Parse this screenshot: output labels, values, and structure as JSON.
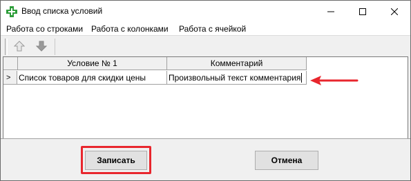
{
  "window": {
    "title": "Ввод списка условий"
  },
  "menu": {
    "items": [
      {
        "label": "Работа со строками"
      },
      {
        "label": "Работа с колонками"
      },
      {
        "label": "Работа с ячейкой"
      }
    ]
  },
  "grid": {
    "columns": [
      {
        "label": "Условие № 1"
      },
      {
        "label": "Комментарий"
      }
    ],
    "rows": [
      {
        "marker": ">",
        "condition": "Список товаров для скидки цены",
        "comment": "Произвольный текст комментария"
      }
    ]
  },
  "buttons": {
    "save": "Записать",
    "cancel": "Отмена"
  },
  "colors": {
    "highlight": "#e8262d",
    "app_icon": "#2e9e3a"
  },
  "icons": [
    "app-cross-icon",
    "minimize-icon",
    "maximize-icon",
    "close-icon",
    "move-up-icon",
    "move-down-icon",
    "red-arrow-icon"
  ]
}
